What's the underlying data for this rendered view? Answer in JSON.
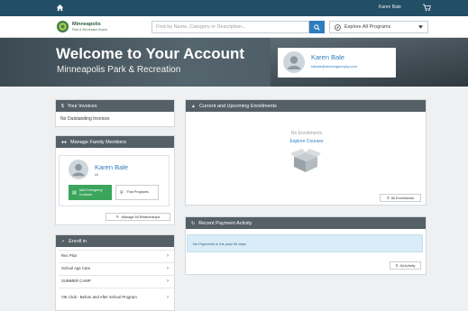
{
  "topbar": {
    "home_icon": "home-icon",
    "user_name": "Karen Bale",
    "cart_icon": "cart-icon"
  },
  "header": {
    "logo_name": "Minneapolis",
    "logo_sub": "Park & Recreation Board",
    "search_placeholder": "Find by Name, Category or Description...",
    "search_icon": "search-icon",
    "explore_label": "Explore All Programs"
  },
  "hero": {
    "title": "Welcome to Your Account",
    "subtitle": "Minneapolis Park & Recreation",
    "account_name": "Karen Bale",
    "account_email": "kabale@acmeagencyky.com"
  },
  "invoices": {
    "title": "Your Invoices",
    "message": "No Outstanding Invoices"
  },
  "family": {
    "title": "Manage Family Members",
    "member_name": "Karen Bale",
    "member_age": "##",
    "add_contact_label": "Add Emergency Contacts",
    "find_programs_label": "Find Programs",
    "manage_relationships_label": "Manage All Relationships"
  },
  "enroll": {
    "title": "Enroll in",
    "items": [
      {
        "label": "Rec Plus"
      },
      {
        "label": "School Age Care"
      },
      {
        "label": "SUMMER CAMP"
      },
      {
        "label": "VIK Club - Before and After School Program"
      }
    ]
  },
  "enrollments": {
    "title": "Current and Upcoming Enrollments",
    "empty_text": "No Enrollments",
    "explore_link": "Explore Courses",
    "all_button": "All Enrollments"
  },
  "payments": {
    "title": "Recent Payment Activity",
    "message": "No Payments in the past 90 days",
    "all_button": "All Activity"
  },
  "colors": {
    "topbar": "#224f66",
    "panel_header": "#555f66",
    "accent_blue": "#2f7dbf",
    "accent_green": "#3ba55c"
  }
}
